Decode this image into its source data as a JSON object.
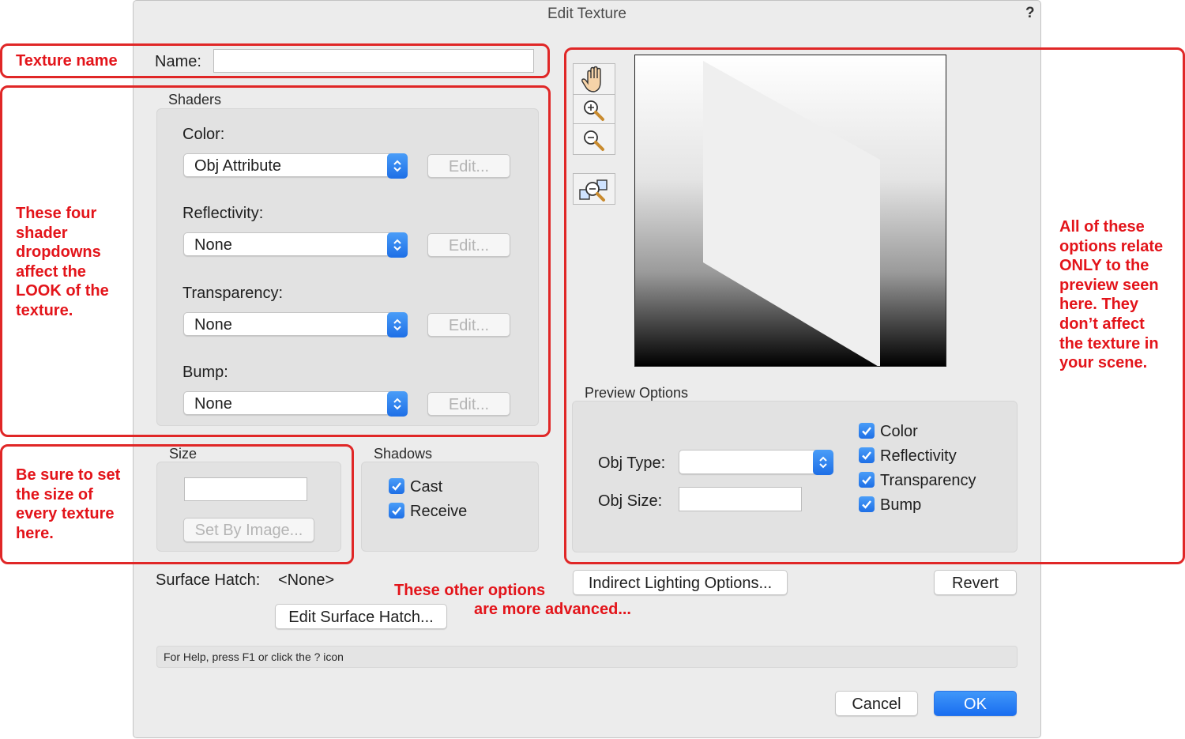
{
  "dialog": {
    "title": "Edit Texture",
    "help_glyph": "?"
  },
  "name_field": {
    "label": "Name:",
    "value": ""
  },
  "shaders": {
    "group_label": "Shaders",
    "rows": [
      {
        "label": "Color:",
        "value": "Obj Attribute",
        "edit": "Edit..."
      },
      {
        "label": "Reflectivity:",
        "value": "None",
        "edit": "Edit..."
      },
      {
        "label": "Transparency:",
        "value": "None",
        "edit": "Edit..."
      },
      {
        "label": "Bump:",
        "value": "None",
        "edit": "Edit..."
      }
    ]
  },
  "size": {
    "group_label": "Size",
    "value": "",
    "set_by_image": "Set By Image..."
  },
  "shadows": {
    "group_label": "Shadows",
    "cast": "Cast",
    "receive": "Receive",
    "cast_checked": true,
    "receive_checked": true
  },
  "surface_hatch": {
    "label": "Surface Hatch:",
    "value": "<None>",
    "edit_button": "Edit Surface Hatch..."
  },
  "preview_tools": [
    "hand-icon",
    "zoom-in-icon",
    "zoom-out-icon",
    "zoom-fit-icon"
  ],
  "preview_options": {
    "group_label": "Preview Options",
    "obj_type_label": "Obj Type:",
    "obj_type_value": "",
    "obj_size_label": "Obj Size:",
    "obj_size_value": "",
    "checkboxes": [
      {
        "label": "Color",
        "checked": true
      },
      {
        "label": "Reflectivity",
        "checked": true
      },
      {
        "label": "Transparency",
        "checked": true
      },
      {
        "label": "Bump",
        "checked": true
      }
    ]
  },
  "buttons": {
    "indirect_lighting": "Indirect Lighting Options...",
    "revert": "Revert",
    "cancel": "Cancel",
    "ok": "OK"
  },
  "status_bar": "For Help, press F1 or click the ? icon",
  "annotations": {
    "texture_name": "Texture name",
    "shaders_note": [
      "These four",
      "shader",
      "dropdowns",
      "affect the",
      "LOOK of the",
      "texture."
    ],
    "size_note": [
      "Be sure to set",
      "the size of",
      "every texture",
      "here."
    ],
    "preview_note": [
      "All of these",
      "options relate",
      "ONLY to the",
      "preview seen",
      "here. They",
      "don’t affect",
      "the texture in",
      "your scene."
    ],
    "advanced_note": [
      "These other options",
      "are more advanced..."
    ]
  },
  "colors": {
    "annotation_red": "#e3141a",
    "accent_blue": "#1e6fe6",
    "dialog_bg": "#ececec"
  }
}
